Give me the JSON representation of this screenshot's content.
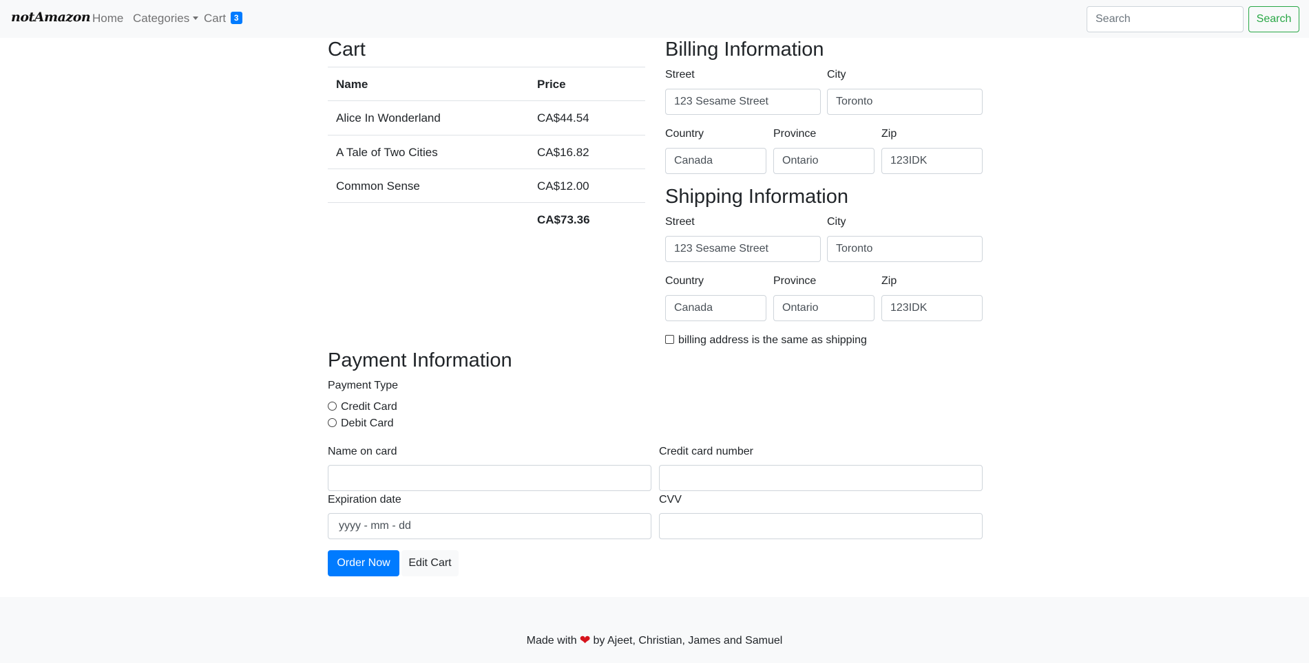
{
  "navbar": {
    "brand": "notAmazon",
    "home": "Home",
    "categories": "Categories",
    "cart": "Cart",
    "cart_count": "3",
    "search_placeholder": "Search",
    "search_button": "Search"
  },
  "cart": {
    "title": "Cart",
    "headers": {
      "name": "Name",
      "price": "Price"
    },
    "items": [
      {
        "name": "Alice In Wonderland",
        "price": "CA$44.54"
      },
      {
        "name": "A Tale of Two Cities",
        "price": "CA$16.82"
      },
      {
        "name": "Common Sense",
        "price": "CA$12.00"
      }
    ],
    "total": "CA$73.36"
  },
  "billing": {
    "title": "Billing Information",
    "street_label": "Street",
    "street": "123 Sesame Street",
    "city_label": "City",
    "city": "Toronto",
    "country_label": "Country",
    "country": "Canada",
    "province_label": "Province",
    "province": "Ontario",
    "zip_label": "Zip",
    "zip": "123IDK"
  },
  "shipping": {
    "title": "Shipping Information",
    "street_label": "Street",
    "street": "123 Sesame Street",
    "city_label": "City",
    "city": "Toronto",
    "country_label": "Country",
    "country": "Canada",
    "province_label": "Province",
    "province": "Ontario",
    "zip_label": "Zip",
    "zip": "123IDK",
    "same_as_label": "billing address is the same as shipping"
  },
  "payment": {
    "title": "Payment Information",
    "type_label": "Payment Type",
    "credit": "Credit Card",
    "debit": "Debit Card",
    "name_label": "Name on card",
    "number_label": "Credit card number",
    "expiry_label": "Expiration date",
    "expiry_placeholder": "yyyy - mm - dd",
    "cvv_label": "CVV"
  },
  "actions": {
    "order": "Order Now",
    "edit": "Edit Cart"
  },
  "footer": {
    "before": "Made with",
    "after": "by Ajeet, Christian, James and Samuel"
  },
  "colors": {
    "primary": "#007bff",
    "success": "#28a745",
    "heart": "#d6141c"
  }
}
